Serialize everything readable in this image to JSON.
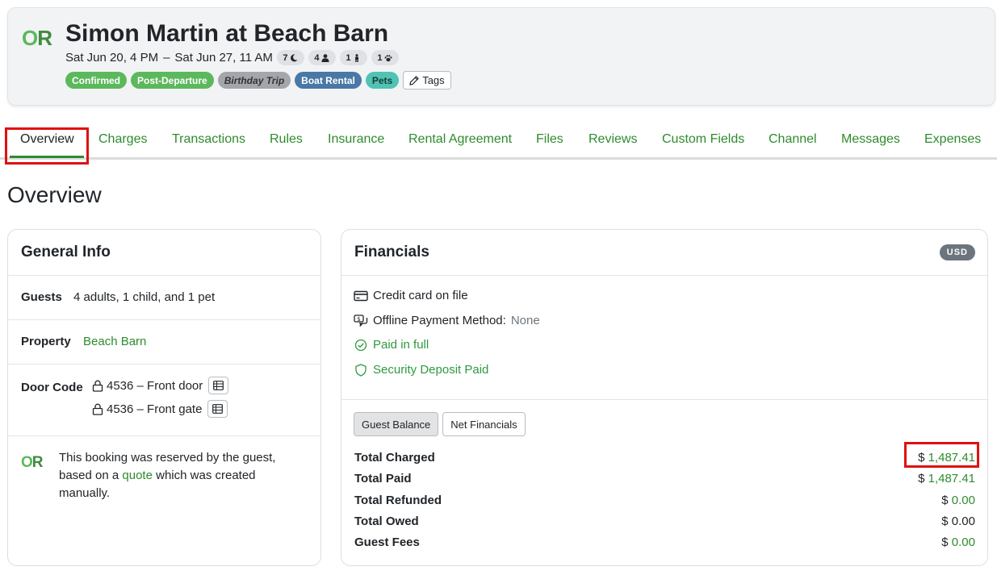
{
  "header": {
    "logo_o": "O",
    "logo_r": "R",
    "title": "Simon Martin at Beach Barn",
    "check_in": "Sat Jun 20, 4 PM",
    "dash": "–",
    "check_out": "Sat Jun 27, 11 AM",
    "pills": [
      {
        "count": "7",
        "icon": "moon-icon"
      },
      {
        "count": "4",
        "icon": "adult-icon"
      },
      {
        "count": "1",
        "icon": "child-icon"
      },
      {
        "count": "1",
        "icon": "paw-icon"
      }
    ],
    "tags": [
      "Confirmed",
      "Post-Departure",
      "Birthday Trip",
      "Boat Rental",
      "Pets"
    ],
    "tags_button": "Tags"
  },
  "tabs": [
    "Overview",
    "Charges",
    "Transactions",
    "Rules",
    "Insurance",
    "Rental Agreement",
    "Files",
    "Reviews",
    "Custom Fields",
    "Channel",
    "Messages",
    "Expenses"
  ],
  "active_tab": "Overview",
  "section_title": "Overview",
  "general_info": {
    "title": "General Info",
    "guests_label": "Guests",
    "guests_value": "4 adults, 1 child, and 1 pet",
    "property_label": "Property",
    "property_value": "Beach Barn",
    "door_code_label": "Door Code",
    "door_codes": [
      "4536 – Front door",
      "4536 – Front gate"
    ],
    "note_prefix": "This booking was reserved by the guest, based on a ",
    "note_link": "quote",
    "note_suffix": " which was created manually."
  },
  "financials": {
    "title": "Financials",
    "currency": "USD",
    "credit_card": "Credit card on file",
    "offline_label": "Offline Payment Method:",
    "offline_value": "None",
    "paid_status": "Paid in full",
    "deposit_status": "Security Deposit Paid",
    "segments": [
      "Guest Balance",
      "Net Financials"
    ],
    "active_segment": "Guest Balance",
    "totals": [
      {
        "label": "Total Charged",
        "currency": "$",
        "amount": "1,487.41"
      },
      {
        "label": "Total Paid",
        "currency": "$",
        "amount": "1,487.41"
      },
      {
        "label": "Total Refunded",
        "currency": "$",
        "amount": "0.00"
      },
      {
        "label": "Total Owed",
        "currency": "$",
        "amount": "0.00"
      },
      {
        "label": "Guest Fees",
        "currency": "$",
        "amount": "0.00"
      }
    ]
  },
  "colors": {
    "accent_green": "#2e8b2e",
    "highlight_red": "#e01010",
    "confirmed_tag": "#5cb85c",
    "boat_tag": "#4a78a6",
    "pets_tag": "#4fc3b4"
  }
}
